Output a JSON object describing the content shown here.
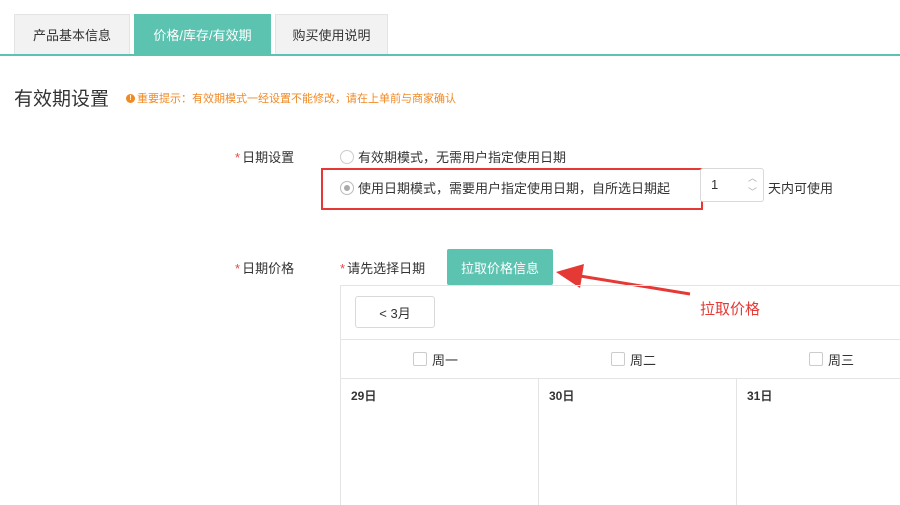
{
  "tabs": [
    {
      "label": "产品基本信息",
      "active": false
    },
    {
      "label": "价格/库存/有效期",
      "active": true
    },
    {
      "label": "购买使用说明",
      "active": false
    }
  ],
  "section": {
    "title": "有效期设置",
    "warning": "重要提示：有效期模式一经设置不能修改，请在上单前与商家确认",
    "warning_icon": "exclamation-icon"
  },
  "date_setting": {
    "required_mark": "*",
    "label": "日期设置",
    "options": [
      {
        "label": "有效期模式，无需用户指定使用日期",
        "checked": false
      },
      {
        "label": "使用日期模式，需要用户指定使用日期，自所选日期起",
        "checked": true
      }
    ],
    "days_value": "1",
    "days_suffix": "天内可使用"
  },
  "date_price": {
    "required_mark": "*",
    "label": "日期价格",
    "hint_required": "*",
    "hint": "请先选择日期",
    "pull_button": "拉取价格信息",
    "annotation": "拉取价格"
  },
  "calendar": {
    "month_button": "< 3月",
    "weekdays": [
      "周一",
      "周二",
      "周三"
    ],
    "days": [
      "29日",
      "30日",
      "31日"
    ]
  },
  "colors": {
    "accent": "#5cc3b0",
    "warning": "#f08a24",
    "annotation_red": "#e53935"
  }
}
